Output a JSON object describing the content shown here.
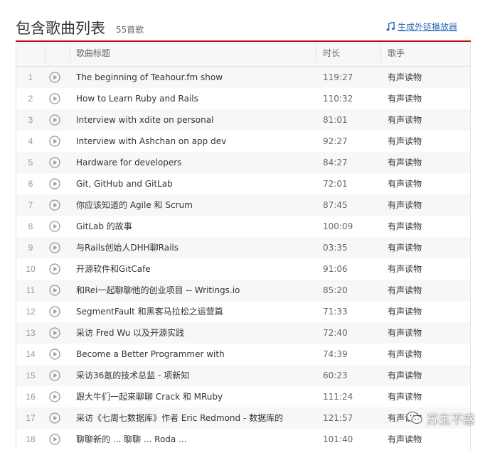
{
  "header": {
    "title": "包含歌曲列表",
    "count": "55首歌",
    "external_player_link": "生成外链播放器"
  },
  "table": {
    "columns": {
      "title": "歌曲标题",
      "duration": "时长",
      "artist": "歌手"
    },
    "rows": [
      {
        "index": "1",
        "title": "The beginning of Teahour.fm show",
        "duration": "119:27",
        "artist": "有声读物"
      },
      {
        "index": "2",
        "title": "How to Learn Ruby and Rails",
        "duration": "110:32",
        "artist": "有声读物"
      },
      {
        "index": "3",
        "title": "Interview with xdite on personal",
        "duration": "81:01",
        "artist": "有声读物"
      },
      {
        "index": "4",
        "title": "Interview with Ashchan on app dev",
        "duration": "92:27",
        "artist": "有声读物"
      },
      {
        "index": "5",
        "title": "Hardware for developers",
        "duration": "84:27",
        "artist": "有声读物"
      },
      {
        "index": "6",
        "title": "Git, GitHub and GitLab",
        "duration": "72:01",
        "artist": "有声读物"
      },
      {
        "index": "7",
        "title": "你应该知道的 Agile 和 Scrum",
        "duration": "87:45",
        "artist": "有声读物"
      },
      {
        "index": "8",
        "title": "GitLab 的故事",
        "duration": "100:09",
        "artist": "有声读物"
      },
      {
        "index": "9",
        "title": "与Rails创始人DHH聊Rails",
        "duration": "03:35",
        "artist": "有声读物"
      },
      {
        "index": "10",
        "title": "开源软件和GitCafe",
        "duration": "91:06",
        "artist": "有声读物"
      },
      {
        "index": "11",
        "title": "和Rei一起聊聊他的创业项目 -- Writings.io",
        "duration": "85:20",
        "artist": "有声读物"
      },
      {
        "index": "12",
        "title": "SegmentFault 和黑客马拉松之运营篇",
        "duration": "71:33",
        "artist": "有声读物"
      },
      {
        "index": "13",
        "title": "采访 Fred Wu 以及开源实践",
        "duration": "72:40",
        "artist": "有声读物"
      },
      {
        "index": "14",
        "title": "Become a Better Programmer with",
        "duration": "74:39",
        "artist": "有声读物"
      },
      {
        "index": "15",
        "title": "采访36氪的技术总监 - 项新知",
        "duration": "60:23",
        "artist": "有声读物"
      },
      {
        "index": "16",
        "title": "跟大牛们一起来聊聊 Crack 和 MRuby",
        "duration": "111:24",
        "artist": "有声读物"
      },
      {
        "index": "17",
        "title": "采访《七周七数据库》作者 Eric Redmond - 数据库的",
        "duration": "121:57",
        "artist": "有声读物"
      },
      {
        "index": "18",
        "title": "聊聊新的 ... 聊聊 ... Roda ...",
        "duration": "101:40",
        "artist": "有声读物"
      }
    ]
  },
  "watermark": {
    "text": "苏生不惑"
  },
  "colors": {
    "accent_red": "#c20c0c",
    "link_blue": "#2f6fb6",
    "row_alt": "#f7f7f7"
  },
  "icons": {
    "external_link": "music-note-icon",
    "play": "play-circle-icon",
    "watermark_logo": "wechat-logo-icon"
  }
}
